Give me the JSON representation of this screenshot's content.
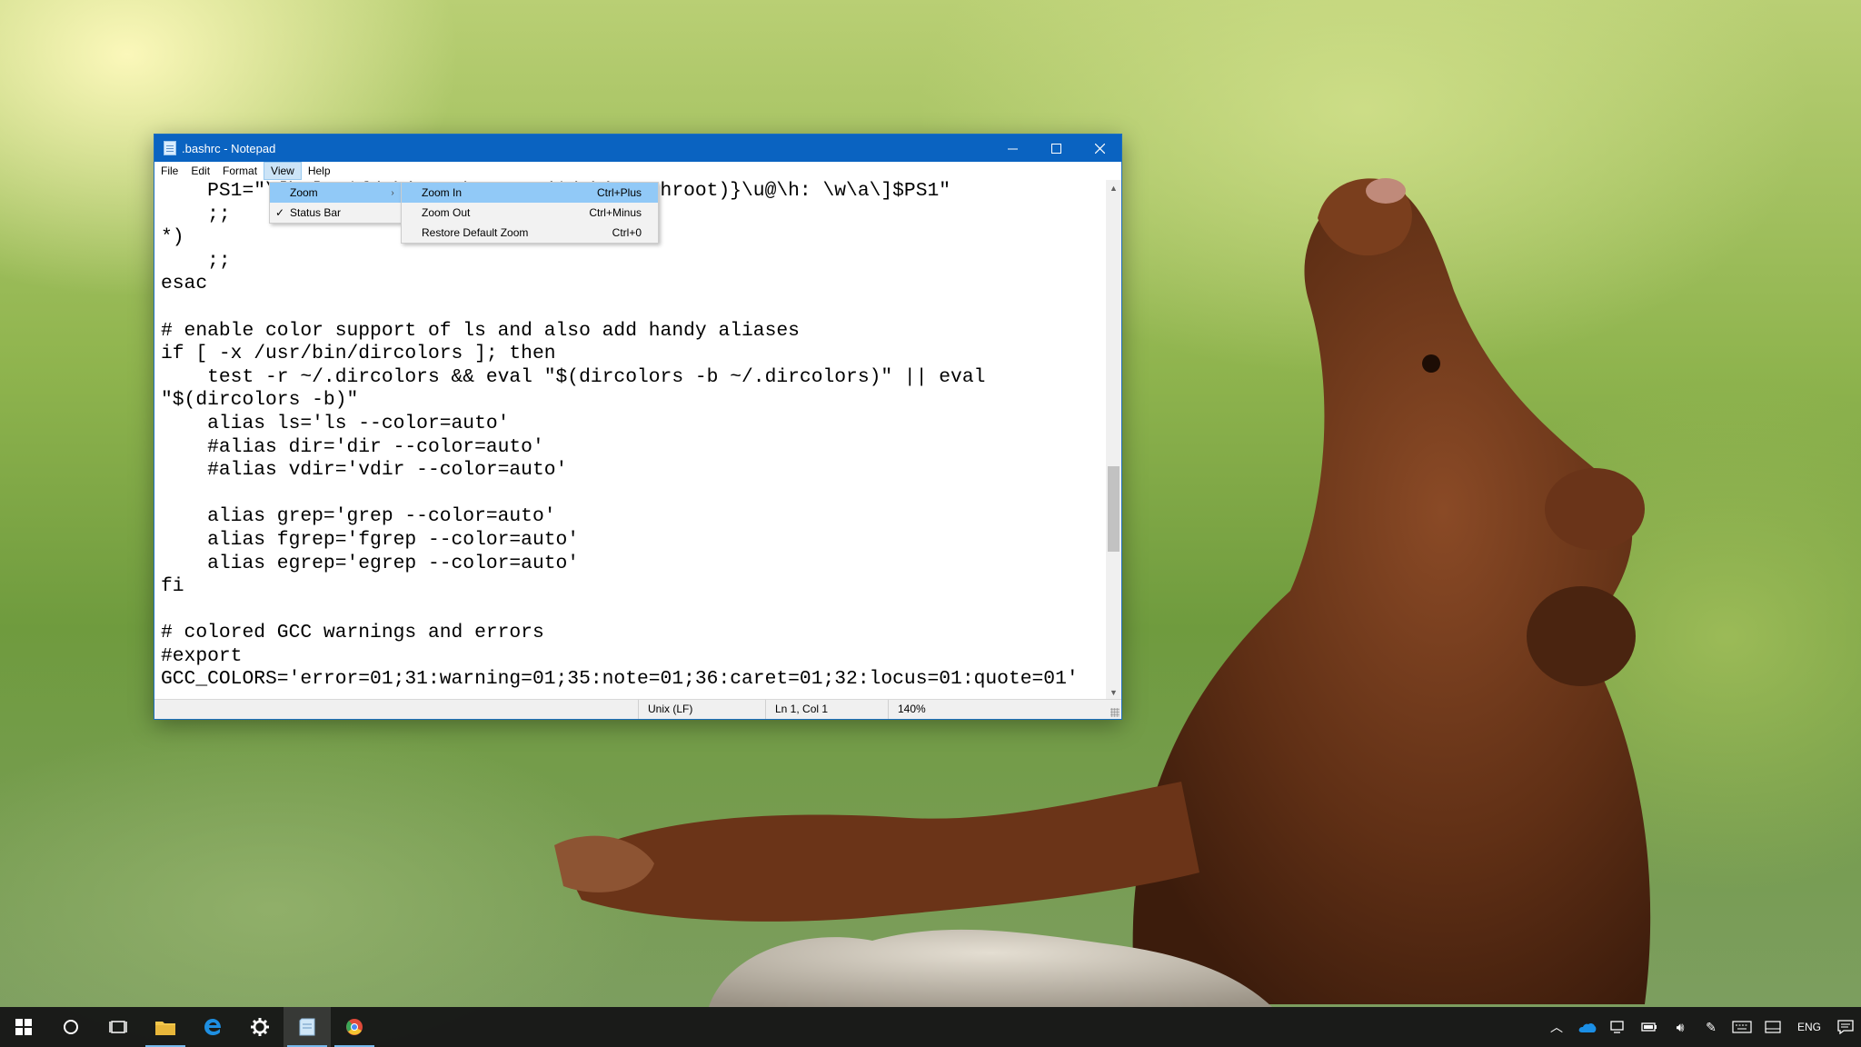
{
  "window": {
    "title": ".bashrc - Notepad"
  },
  "menubar": {
    "items": [
      "File",
      "Edit",
      "Format",
      "View",
      "Help"
    ]
  },
  "editor": {
    "lines": [
      "    PS1=\"\\[\\e]0;${debian_chroot:+($debian_chroot)}\\u@\\h: \\w\\a\\]$PS1\"",
      "    ;;",
      "*)",
      "    ;;",
      "esac",
      "",
      "# enable color support of ls and also add handy aliases",
      "if [ -x /usr/bin/dircolors ]; then",
      "    test -r ~/.dircolors && eval \"$(dircolors -b ~/.dircolors)\" || eval",
      "\"$(dircolors -b)\"",
      "    alias ls='ls --color=auto'",
      "    #alias dir='dir --color=auto'",
      "    #alias vdir='vdir --color=auto'",
      "",
      "    alias grep='grep --color=auto'",
      "    alias fgrep='fgrep --color=auto'",
      "    alias egrep='egrep --color=auto'",
      "fi",
      "",
      "# colored GCC warnings and errors",
      "#export",
      "GCC_COLORS='error=01;31:warning=01;35:note=01;36:caret=01;32:locus=01:quote=01'"
    ]
  },
  "view_menu": {
    "items": [
      {
        "label": "Zoom",
        "checked": false,
        "submenu": true
      },
      {
        "label": "Status Bar",
        "checked": true,
        "submenu": false
      }
    ]
  },
  "zoom_menu": {
    "items": [
      {
        "label": "Zoom In",
        "shortcut": "Ctrl+Plus"
      },
      {
        "label": "Zoom Out",
        "shortcut": "Ctrl+Minus"
      },
      {
        "label": "Restore Default Zoom",
        "shortcut": "Ctrl+0"
      }
    ]
  },
  "statusbar": {
    "encoding": "Unix (LF)",
    "position": "Ln 1, Col 1",
    "zoom": "140%"
  },
  "taskbar": {
    "language": "ENG"
  },
  "colors": {
    "titlebar": "#0a63c1",
    "menu_highlight": "#91c9f7",
    "taskbar": "#161616"
  }
}
